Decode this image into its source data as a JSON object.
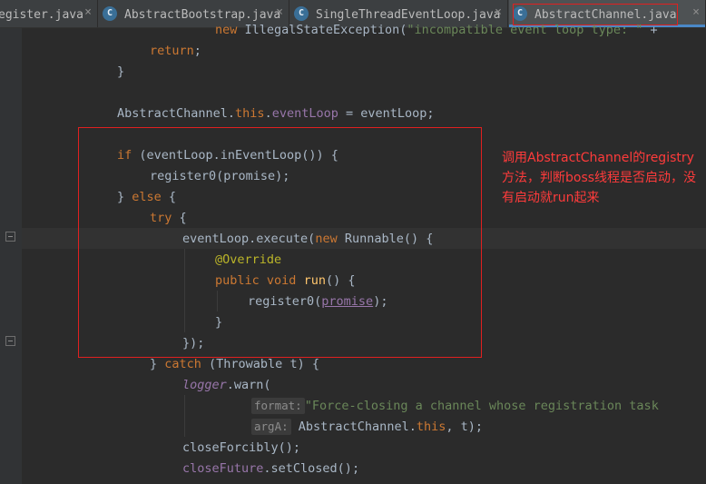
{
  "tabs": [
    {
      "label": "egister.java",
      "active": false
    },
    {
      "label": "AbstractBootstrap.java",
      "active": false
    },
    {
      "label": "SingleThreadEventLoop.java",
      "active": false
    },
    {
      "label": "AbstractChannel.java",
      "active": true
    }
  ],
  "tab_close_glyph": "×",
  "class_icon_glyph": "C",
  "code": {
    "l0": {
      "kw": "new",
      "t1": " IllegalStateException(",
      "str": "\"incompatible event loop type: \"",
      "t2": " +"
    },
    "l1": {
      "kw": "return",
      "t1": ";"
    },
    "l2": {
      "t": "}"
    },
    "l4": {
      "t1": "AbstractChannel.",
      "kw": "this",
      "t2": ".",
      "fld": "eventLoop",
      "t3": " = eventLoop;"
    },
    "l6": {
      "kw": "if",
      "t1": " (eventLoop.inEventLoop()) {"
    },
    "l7": {
      "t": "register0(promise);"
    },
    "l8": {
      "t1": "} ",
      "kw": "else",
      "t2": " {"
    },
    "l9": {
      "kw": "try",
      "t1": " {"
    },
    "l10": {
      "t1": "eventLoop.execute(",
      "kw": "new",
      "t2": " Runnable() {"
    },
    "l11": {
      "ann": "@Override"
    },
    "l12": {
      "kw1": "public",
      "kw2": "void",
      "t1": "run",
      "t2": "() {"
    },
    "l13": {
      "t1": "register0(",
      "fld": "promise",
      "t2": ");"
    },
    "l14": {
      "t": "}"
    },
    "l15": {
      "t": "});"
    },
    "l16": {
      "t1": "} ",
      "kw": "catch",
      "t2": " (Throwable t) {"
    },
    "l17": {
      "it": "logger",
      "t1": ".warn("
    },
    "l18": {
      "hint": "format:",
      "str": "\"Force-closing a channel whose registration task"
    },
    "l19": {
      "hint": "argA:",
      "t1": "AbstractChannel.",
      "kw": "this",
      "t2": ", t);"
    },
    "l20": {
      "t": "closeForcibly();"
    },
    "l21": {
      "fld": "closeFuture",
      "t1": ".setClosed();"
    }
  },
  "annotation_note": "调用AbstractChannel的registry方法，判断boss线程是否启动，没有启动就run起来",
  "colors": {
    "editor_bg": "#2b2b2b",
    "keyword": "#cc7832",
    "field": "#9876aa",
    "string": "#6a8759",
    "annotation": "#bbb529",
    "note_red": "#ff3b3b"
  }
}
